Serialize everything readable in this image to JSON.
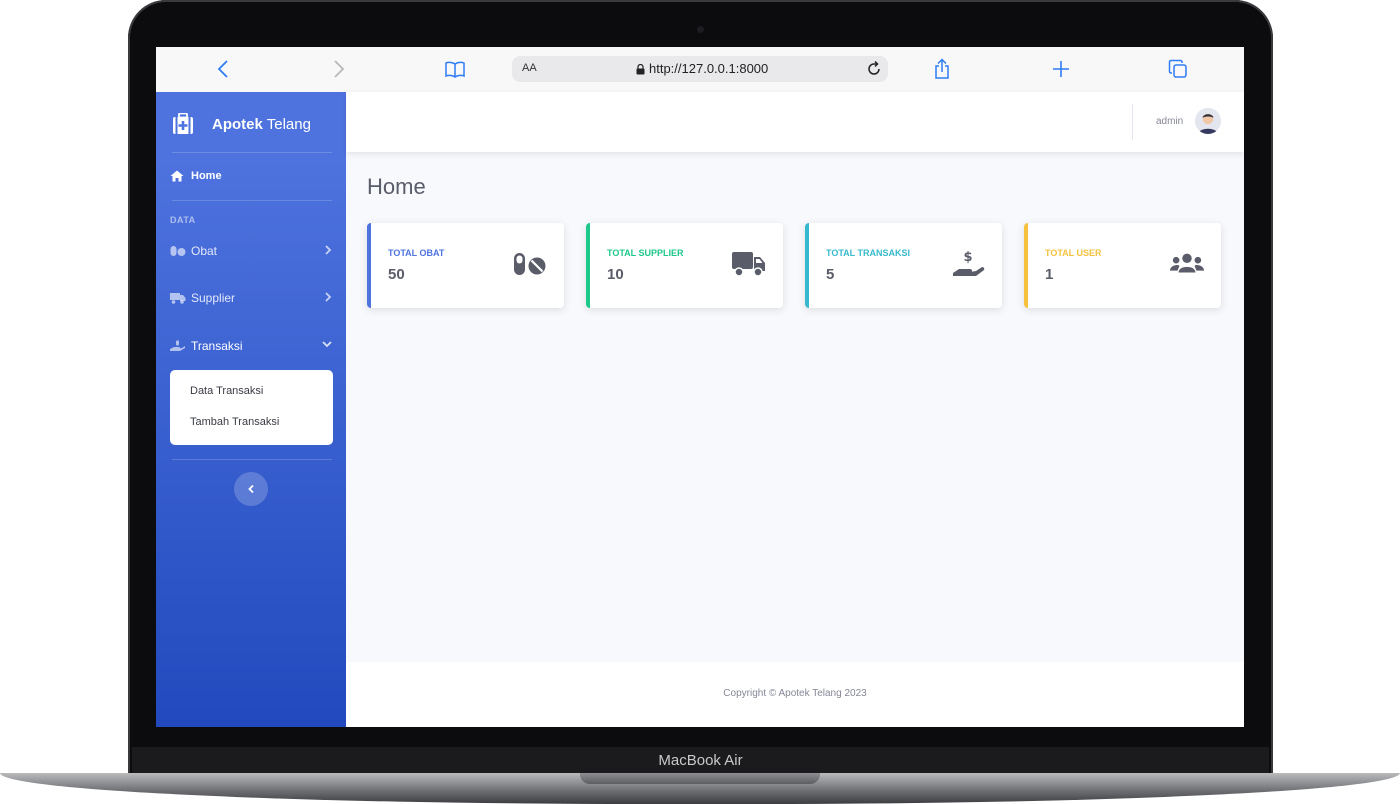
{
  "device": {
    "label": "MacBook Air"
  },
  "browser": {
    "address_prefix": "AA",
    "url": "http://127.0.0.1:8000"
  },
  "sidebar": {
    "brand_bold": "Apotek",
    "brand_rest": " Telang",
    "home_label": "Home",
    "section_heading": "DATA",
    "items": [
      {
        "label": "Obat",
        "icon": "pills-icon"
      },
      {
        "label": "Supplier",
        "icon": "truck-icon"
      },
      {
        "label": "Transaksi",
        "icon": "hand-dollar-icon"
      }
    ],
    "submenu": [
      "Data Transaksi",
      "Tambah Transaksi"
    ]
  },
  "topbar": {
    "username": "admin"
  },
  "page": {
    "title": "Home"
  },
  "cards": [
    {
      "label": "TOTAL OBAT",
      "value": "50",
      "color": "#4e73df",
      "icon": "pills-icon"
    },
    {
      "label": "TOTAL SUPPLIER",
      "value": "10",
      "color": "#1cc88a",
      "icon": "truck-icon"
    },
    {
      "label": "TOTAL TRANSAKSI",
      "value": "5",
      "color": "#36b9cc",
      "icon": "hand-dollar-icon"
    },
    {
      "label": "TOTAL USER",
      "value": "1",
      "color": "#f6c23e",
      "icon": "users-icon"
    }
  ],
  "footer": {
    "text": "Copyright © Apotek Telang 2023"
  }
}
